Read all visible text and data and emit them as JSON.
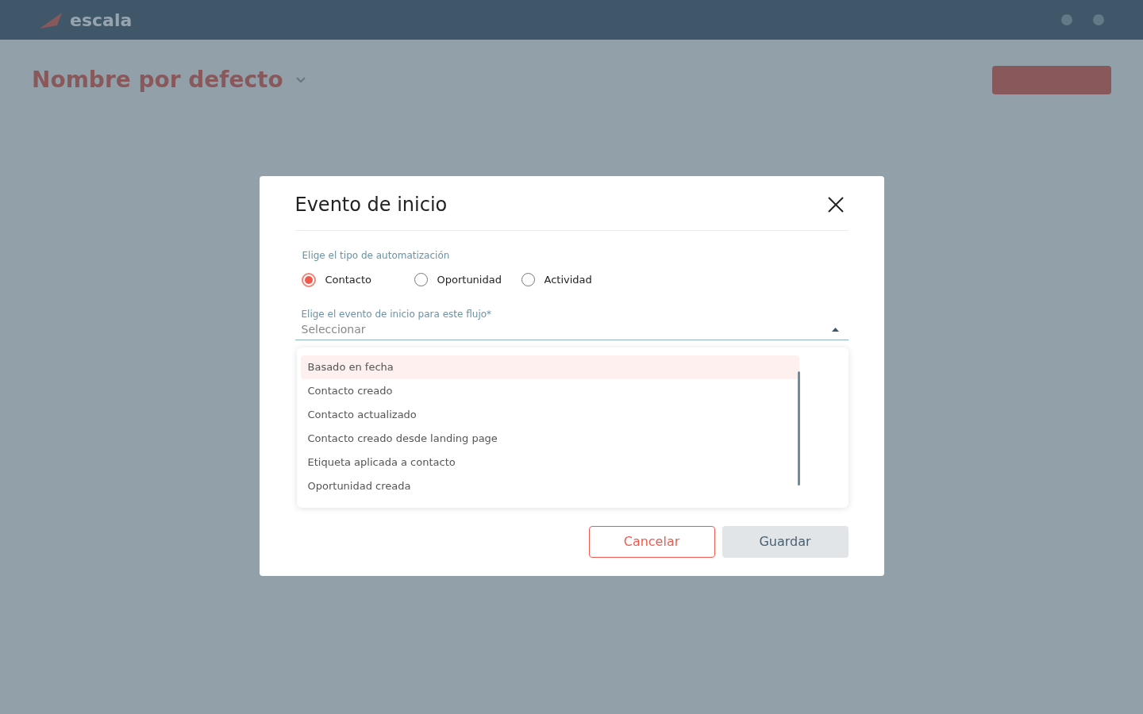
{
  "top_bar": {
    "logo_text": "escala"
  },
  "page": {
    "title": "Nombre por defecto"
  },
  "modal": {
    "title": "Evento de inicio",
    "automation_type": {
      "label": "Elige el tipo de automatización",
      "options": [
        {
          "label": "Contacto",
          "selected": true
        },
        {
          "label": "Oportunidad",
          "selected": false
        },
        {
          "label": "Actividad",
          "selected": false
        }
      ]
    },
    "start_event": {
      "label": "Elige el evento de inicio para este flujo*",
      "placeholder": "Seleccionar",
      "expanded": true,
      "options": [
        {
          "label": "Basado en fecha",
          "highlighted": true
        },
        {
          "label": "Contacto creado",
          "highlighted": false
        },
        {
          "label": "Contacto actualizado",
          "highlighted": false
        },
        {
          "label": "Contacto creado desde landing page",
          "highlighted": false
        },
        {
          "label": "Etiqueta aplicada a contacto",
          "highlighted": false
        },
        {
          "label": "Oportunidad creada",
          "highlighted": false
        }
      ]
    },
    "buttons": [
      {
        "kind": "secondary",
        "label": "Cancelar"
      },
      {
        "kind": "primary",
        "label": "Guardar"
      }
    ]
  }
}
